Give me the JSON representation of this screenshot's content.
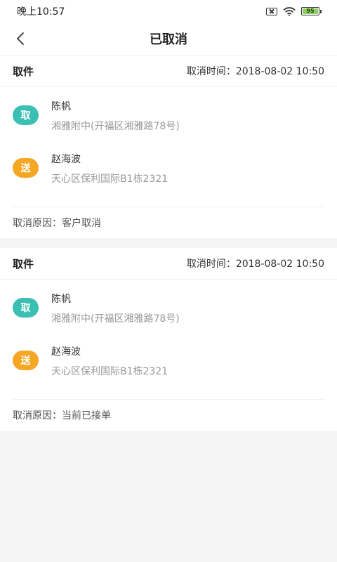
{
  "status_bar": {
    "time": "晚上10:57",
    "battery_level": "95",
    "battery_color": "#8dd05e"
  },
  "nav": {
    "title": "已取消",
    "back_icon": "chevron-left-icon"
  },
  "colors": {
    "pickup_badge": "#3cbfb3",
    "delivery_badge": "#f5a623"
  },
  "orders": [
    {
      "type": "取件",
      "cancel_time": "取消时间：2018-08-02 10:50",
      "pickup": {
        "badge": "取",
        "name": "陈帆",
        "address": "湘雅附中(开福区湘雅路78号)"
      },
      "delivery": {
        "badge": "送",
        "name": "赵海波",
        "address": "天心区保利国际B1栋2321"
      },
      "reason": "取消原因：客户取消"
    },
    {
      "type": "取件",
      "cancel_time": "取消时间：2018-08-02 10:50",
      "pickup": {
        "badge": "取",
        "name": "陈帆",
        "address": "湘雅附中(开福区湘雅路78号)"
      },
      "delivery": {
        "badge": "送",
        "name": "赵海波",
        "address": "天心区保利国际B1栋2321"
      },
      "reason": "取消原因：当前已接单"
    }
  ]
}
